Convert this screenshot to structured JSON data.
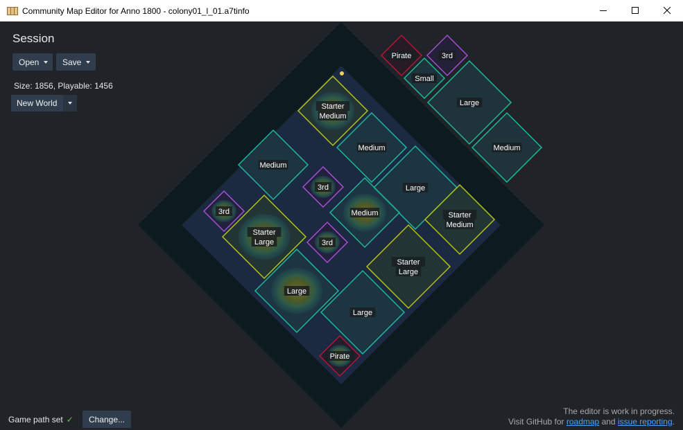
{
  "window": {
    "title": "Community Map Editor for Anno 1800  - colony01_l_01.a7tinfo",
    "minimize_icon": "minimize-icon",
    "maximize_icon": "maximize-icon",
    "close_icon": "close-icon"
  },
  "panel": {
    "session_title": "Session",
    "open_label": "Open",
    "save_label": "Save",
    "size_text": "Size: 1856, Playable: 1456",
    "region_selected": "New World"
  },
  "footer": {
    "game_path_text": "Game path set",
    "check_icon": "✓",
    "change_label": "Change...",
    "status_line": "The editor is work in progress.",
    "visit_prefix": "Visit GitHub for ",
    "roadmap_link": "roadmap",
    "and_text": " and ",
    "issue_link": "issue reporting",
    "period": "."
  },
  "colors": {
    "outer_area": "#0d1a20",
    "playable_area": "#1b2a40",
    "medium_large_border": "#1fb89c",
    "starter_border": "#b5c41a",
    "third_party_border": "#a64fd6",
    "pirate_border": "#b3153c",
    "small_border": "#1fb89c"
  },
  "islands": [
    {
      "id": "pirate-top",
      "line1": "Pirate",
      "line2": "",
      "type": "pirate"
    },
    {
      "id": "third-top",
      "line1": "3rd",
      "line2": "",
      "type": "third"
    },
    {
      "id": "small-top",
      "line1": "Small",
      "line2": "",
      "type": "normal"
    },
    {
      "id": "large-top",
      "line1": "Large",
      "line2": "",
      "type": "normal"
    },
    {
      "id": "medium-outside",
      "line1": "Medium",
      "line2": "",
      "type": "normal"
    },
    {
      "id": "starter-medium-top",
      "line1": "Starter",
      "line2": "Medium",
      "type": "starter"
    },
    {
      "id": "medium-1",
      "line1": "Medium",
      "line2": "",
      "type": "normal"
    },
    {
      "id": "medium-2",
      "line1": "Medium",
      "line2": "",
      "type": "normal"
    },
    {
      "id": "third-center",
      "line1": "3rd",
      "line2": "",
      "type": "third"
    },
    {
      "id": "large-center",
      "line1": "Large",
      "line2": "",
      "type": "normal"
    },
    {
      "id": "medium-center",
      "line1": "Medium",
      "line2": "",
      "type": "normal"
    },
    {
      "id": "starter-medium-right",
      "line1": "Starter",
      "line2": "Medium",
      "type": "starter"
    },
    {
      "id": "third-left",
      "line1": "3rd",
      "line2": "",
      "type": "third"
    },
    {
      "id": "starter-large-left",
      "line1": "Starter",
      "line2": "Large",
      "type": "starter"
    },
    {
      "id": "third-lower",
      "line1": "3rd",
      "line2": "",
      "type": "third"
    },
    {
      "id": "starter-large-right",
      "line1": "Starter",
      "line2": "Large",
      "type": "starter"
    },
    {
      "id": "large-lower-left",
      "line1": "Large",
      "line2": "",
      "type": "normal"
    },
    {
      "id": "large-bottom",
      "line1": "Large",
      "line2": "",
      "type": "normal"
    },
    {
      "id": "pirate-bottom",
      "line1": "Pirate",
      "line2": "",
      "type": "pirate"
    }
  ]
}
